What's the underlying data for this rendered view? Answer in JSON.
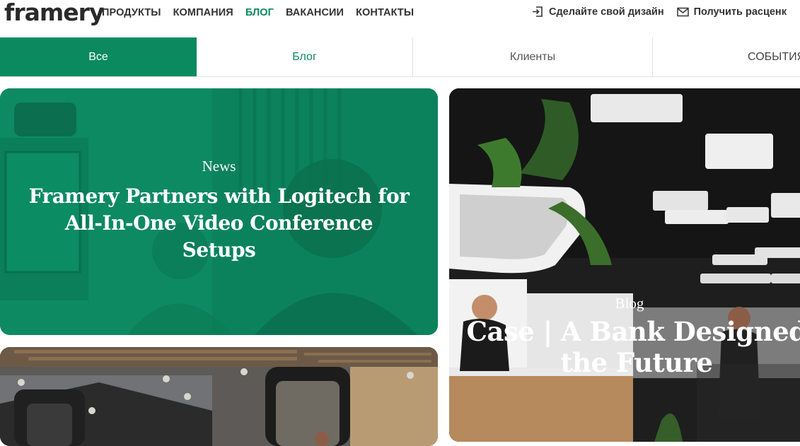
{
  "header": {
    "logo": "framery",
    "nav": [
      "ПРОДУКТЫ",
      "КОМПАНИЯ",
      "БЛОГ",
      "ВАКАНСИИ",
      "КОНТАКТЫ"
    ],
    "active_nav": "БЛОГ",
    "design_label": "Сделайте свой дизайн",
    "quote_label": "Получить расценк"
  },
  "tabs": [
    "Все",
    "Блог",
    "Клиенты",
    "СОБЫТИЯ"
  ],
  "active_tab": "Все",
  "cards": [
    {
      "category": "News",
      "title": "Framery Partners with Logitech for All-In-One Video Conference Setups"
    },
    {
      "category": "Blog",
      "title_line1": "Case | A Bank Designed",
      "title_line2": "the Future"
    }
  ],
  "colors": {
    "accent": "#0b8a5f",
    "card_green": "#0d8a62"
  }
}
